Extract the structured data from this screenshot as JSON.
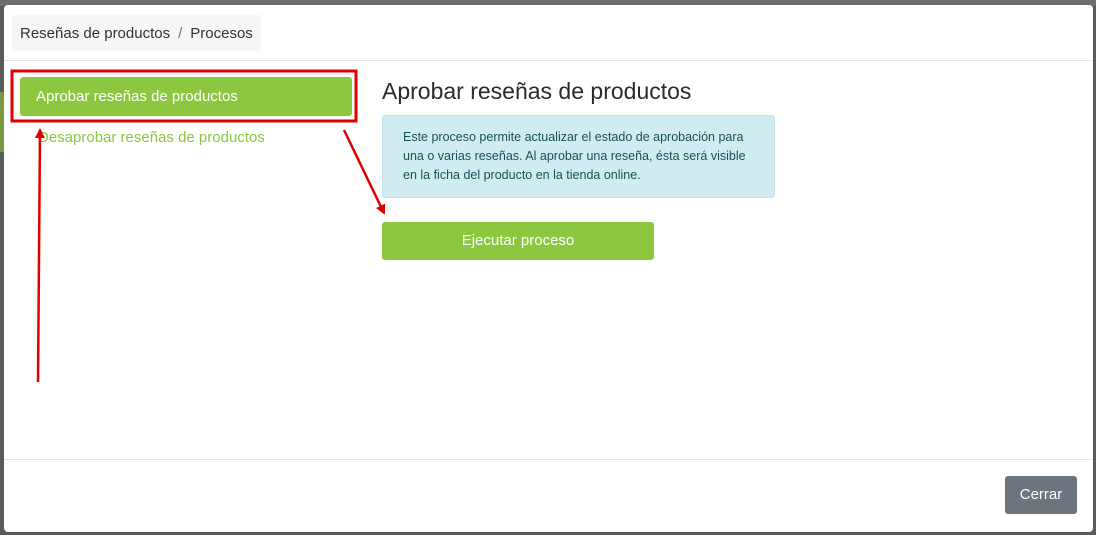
{
  "breadcrumb": {
    "items": [
      "Reseñas de productos",
      "Procesos"
    ],
    "separator": "/"
  },
  "side_nav": {
    "items": [
      {
        "label": "Aprobar reseñas de productos",
        "active": true
      },
      {
        "label": "Desaprobar reseñas de productos",
        "active": false
      }
    ]
  },
  "content": {
    "title": "Aprobar reseñas de productos",
    "info_text": "Este proceso permite actualizar el estado de aprobación para una o varias reseñas. Al aprobar una reseña, ésta será visible en la ficha del producto en la tienda online.",
    "run_button_label": "Ejecutar proceso"
  },
  "footer": {
    "close_label": "Cerrar"
  },
  "colors": {
    "accent_green": "#8dc63f",
    "info_bg": "#d1ecf1",
    "close_gray": "#6c757d",
    "annotation_red": "#e00000"
  }
}
